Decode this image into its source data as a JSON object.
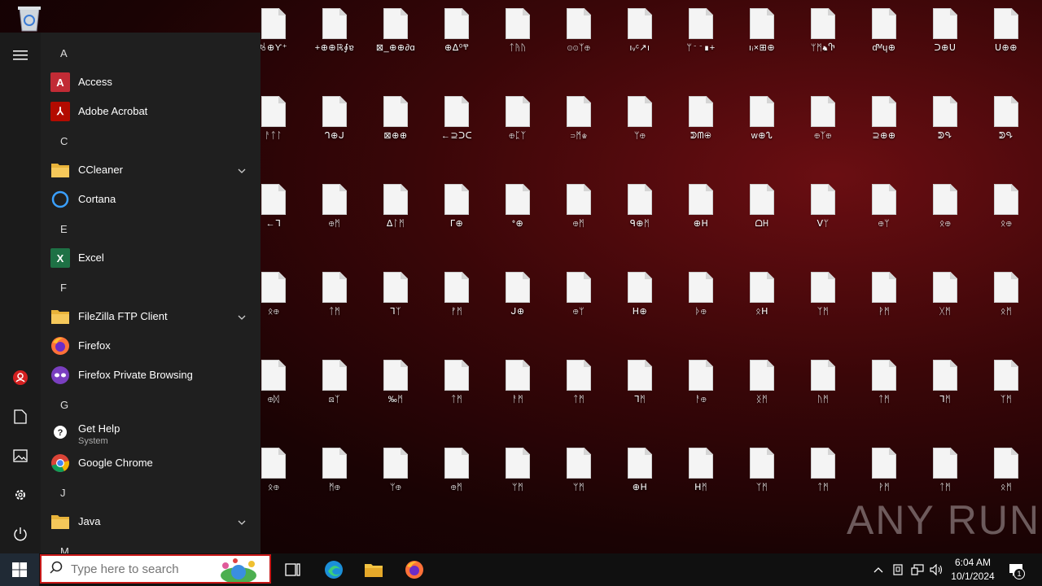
{
  "desktop": {
    "recycle_bin": "recycle-bin-icon",
    "icons": [
      [
        "ꂙ⊕ϒ⁺",
        "+⊕⊕ℝ∮ɐ",
        "⊠_⊕⊕∂ɑ",
        "⊕ᐃ⁰ⰹ",
        "ᛏᚤᚢ",
        "⊙⊙ᛉ⊕",
        "ıᵥᶜ↗ı",
        "ᛘ⁻⁻∎+",
        "ıᵢ×⊞⊕",
        "ᛘᛗ♞Ⴅ",
        "ɗᴹɥ⊕",
        "ᑐ⊕ᑌ",
        "ᑌ⊕⊕"
      ],
      [
        "ᚨᛏᛚ",
        "ᒉ⊕ᒍ",
        "⊠⊕⊕",
        "←⊇ᑐᑕ",
        "⊕ᛈᛉ",
        "⊃ᛗ♔",
        "ᛘ⊕",
        "ᕲᗰ⊕",
        "ᴡ⊕ᔐ",
        "⊕ᛉ⊕",
        "⊇⊕⊕",
        "ᕲᕴ",
        "ᕲᕴ"
      ],
      [
        "←ᒣ",
        "⊕ᛗ",
        "ᐃᛚᛗ",
        "ᒥ⊕",
        "ᐤ⊕",
        "⊕ᛗ",
        "ᑫ⊕ᛗ",
        "⊕ᕼ",
        "ᗝᕼ",
        "ᐯᛘ",
        "⊕ᛘ",
        "ᛟ⊕",
        "ᛟ⊕"
      ],
      [
        "ᛟ⊕",
        "ᛏᛗ",
        "ᒣᛉ",
        "ᚠᛗ",
        "ᒍ⊕",
        "⊕ᛘ",
        "ᕼ⊕",
        "ᚦ⊕",
        "ᛟᕼ",
        "ᛉᛗ",
        "ᚹᛗ",
        "ᚷᛗ",
        "ᛟᛗ"
      ],
      [
        "⊕ᛞ",
        "⊠ᛉ",
        "‰ᛗ",
        "ᛏᛗ",
        "ᚨᛗ",
        "ᛏᛗ",
        "ᒣᛗ",
        "ᚨ⊕",
        "ᛝᛗ",
        "ᚢᛗ",
        "ᛏᛗ",
        "ᒣᛗ",
        "ᛉᛗ"
      ],
      [
        "ᛟ⊕",
        "ᛗ⊕",
        "ᛘ⊕",
        "⊕ᛗ",
        "ᛘᛗ",
        "ᛘᛗ",
        "⊕ᕼ",
        "ᕼᛗ",
        "ᛉᛗ",
        "ᛏᛗ",
        "ᚹᛗ",
        "ᛏᛗ",
        "ᛟᛗ"
      ]
    ]
  },
  "start_menu": {
    "groups": [
      {
        "letter": "A",
        "apps": [
          {
            "name": "Access",
            "icon": "access-icon",
            "color": "#c12b35"
          },
          {
            "name": "Adobe Acrobat",
            "icon": "acrobat-icon",
            "color": "#b30b00"
          }
        ]
      },
      {
        "letter": "C",
        "apps": [
          {
            "name": "CCleaner",
            "icon": "folder-icon",
            "color": "#e8b33a",
            "expand": true
          },
          {
            "name": "Cortana",
            "icon": "cortana-icon",
            "color": "#3aa0ff"
          }
        ]
      },
      {
        "letter": "E",
        "apps": [
          {
            "name": "Excel",
            "icon": "excel-icon",
            "color": "#1e7145"
          }
        ]
      },
      {
        "letter": "F",
        "apps": [
          {
            "name": "FileZilla FTP Client",
            "icon": "folder-icon",
            "color": "#e8b33a",
            "expand": true
          },
          {
            "name": "Firefox",
            "icon": "firefox-icon",
            "color": "#ff7139"
          },
          {
            "name": "Firefox Private Browsing",
            "icon": "firefox-private-icon",
            "color": "#7a3fc0"
          }
        ]
      },
      {
        "letter": "G",
        "apps": [
          {
            "name": "Get Help",
            "sub": "System",
            "icon": "get-help-icon",
            "color": "#3aa0ff"
          },
          {
            "name": "Google Chrome",
            "icon": "chrome-icon",
            "color": "#4285f4"
          }
        ]
      },
      {
        "letter": "J",
        "apps": [
          {
            "name": "Java",
            "icon": "folder-icon",
            "color": "#e8b33a",
            "expand": true
          }
        ]
      },
      {
        "letter": "M",
        "apps": []
      }
    ]
  },
  "taskbar": {
    "search_placeholder": "Type here to search",
    "time": "6:04 AM",
    "date": "10/1/2024",
    "notification_count": "1"
  },
  "watermark": "ANY RUN"
}
